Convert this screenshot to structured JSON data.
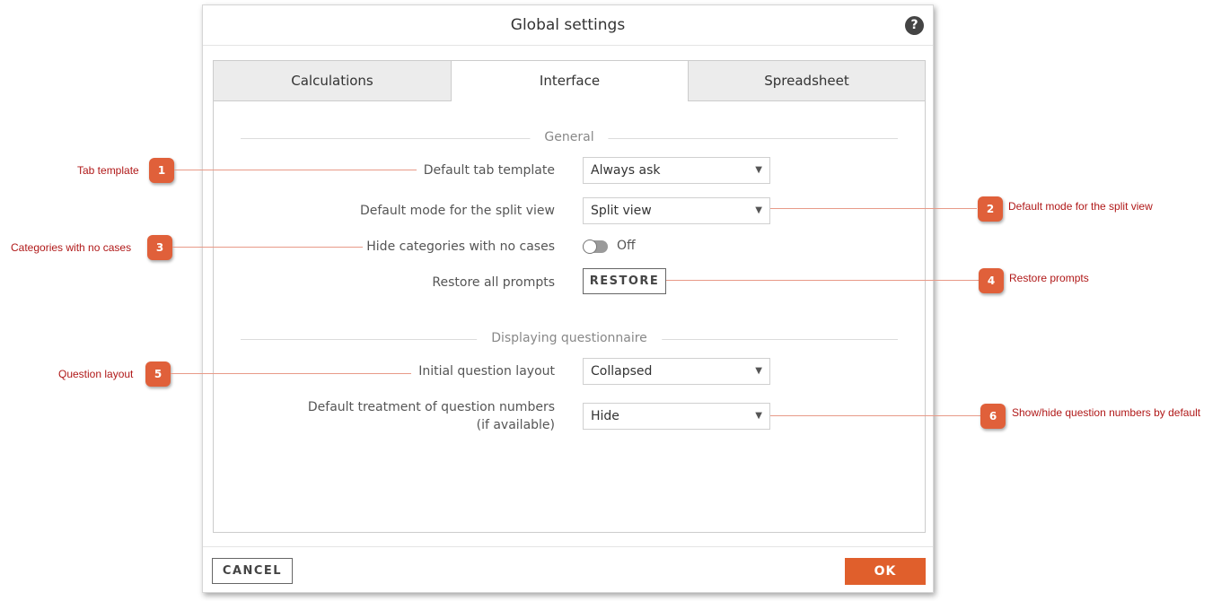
{
  "dialog": {
    "title": "Global settings",
    "help_icon": "question-icon"
  },
  "tabs": [
    {
      "label": "Calculations",
      "active": false
    },
    {
      "label": "Interface",
      "active": true
    },
    {
      "label": "Spreadsheet",
      "active": false
    }
  ],
  "sections": {
    "general": "General",
    "questionnaire": "Displaying questionnaire"
  },
  "fields": {
    "tab_template": {
      "label": "Default tab template",
      "value": "Always ask"
    },
    "split_view": {
      "label": "Default mode for the split view",
      "value": "Split view"
    },
    "hide_categories": {
      "label": "Hide categories with no cases",
      "state": "Off"
    },
    "restore_prompts": {
      "label": "Restore all prompts",
      "button": "RESTORE"
    },
    "question_layout": {
      "label": "Initial question layout",
      "value": "Collapsed"
    },
    "question_numbers": {
      "label_line1": "Default treatment of question numbers",
      "label_line2": "(if available)",
      "value": "Hide"
    }
  },
  "footer": {
    "cancel": "CANCEL",
    "ok": "OK"
  },
  "callouts": [
    {
      "num": "1",
      "text": "Tab template"
    },
    {
      "num": "2",
      "text": "Default mode for the split view"
    },
    {
      "num": "3",
      "text": "Categories with no cases"
    },
    {
      "num": "4",
      "text": "Restore prompts"
    },
    {
      "num": "5",
      "text": "Question layout"
    },
    {
      "num": "6",
      "text": "Show/hide question numbers by default"
    }
  ],
  "colors": {
    "accent": "#e05f2c",
    "callout_text": "#b01818",
    "badge": "#e0603a"
  }
}
